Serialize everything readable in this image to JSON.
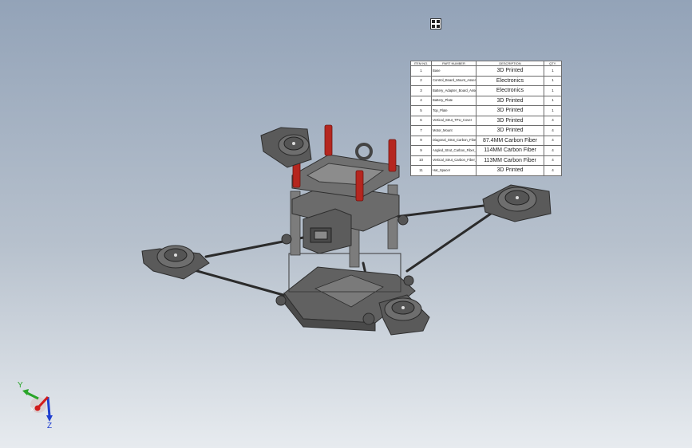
{
  "view_button": {
    "icon": "four-view-icon"
  },
  "bom": {
    "headers": [
      "ITEM NO.",
      "PART NUMBER",
      "DESCRIPTION",
      "QTY."
    ],
    "rows": [
      [
        "1",
        "Base",
        "3D Printed",
        "1"
      ],
      [
        "2",
        "Control_Board_Mount_Assembly_V2",
        "Electronics",
        "1"
      ],
      [
        "3",
        "Battery_Adapter_Board_Assembly_V2",
        "Electronics",
        "1"
      ],
      [
        "4",
        "Battery_Plate",
        "3D Printed",
        "1"
      ],
      [
        "5",
        "Top_Plate",
        "3D Printed",
        "1"
      ],
      [
        "6",
        "Vertical_Strut_TPU_Cover",
        "3D Printed",
        "4"
      ],
      [
        "7",
        "Motor_Mount",
        "3D Printed",
        "4"
      ],
      [
        "9",
        "Diagonal_Strut_Carbon_Fiber_V2",
        "87.4MM Carbon Fiber",
        "4"
      ],
      [
        "9",
        "Angled_Strut_Carbon_Fiber_V2",
        "114MM Carbon Fiber",
        "4"
      ],
      [
        "10",
        "Vertical_Strut_Carbon_Fiber_V2",
        "113MM Carbon Fiber",
        "4"
      ],
      [
        "11",
        "Hat_Spacer",
        "3D Printed",
        "4"
      ]
    ]
  },
  "triad": {
    "x_label": "X",
    "y_label": "Y",
    "z_label": "Z"
  },
  "colors": {
    "part_gray": "#6e6e6e",
    "part_dark": "#3d3d3d",
    "standoff_red": "#b5261f",
    "axis_x": "#d11a1a",
    "axis_y": "#2aa52a",
    "axis_z": "#1f3fd0"
  }
}
